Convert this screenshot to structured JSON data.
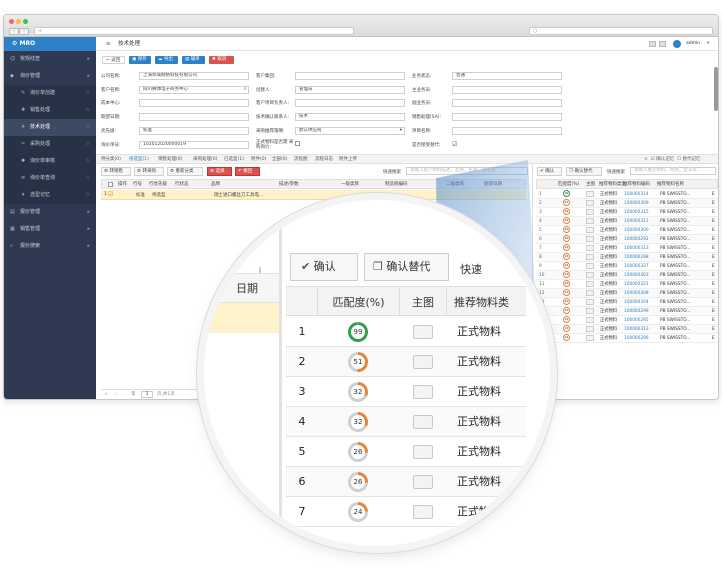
{
  "app": {
    "brand": "MRO",
    "title": "技术处理",
    "user": "admin"
  },
  "sidebar": {
    "items": [
      {
        "label": "常规线查",
        "icon": "user-icon"
      },
      {
        "label": "询价管理",
        "icon": "tag-icon"
      },
      {
        "label": "询价单创建",
        "icon": "pencil-icon",
        "sub": true
      },
      {
        "label": "销售处理",
        "icon": "cart-icon",
        "sub": true
      },
      {
        "label": "技术处理",
        "icon": "wrench-icon",
        "sub": true,
        "active": true
      },
      {
        "label": "采购处理",
        "icon": "gavel-icon",
        "sub": true
      },
      {
        "label": "询价单审核",
        "icon": "gear-icon",
        "sub": true
      },
      {
        "label": "询价单查询",
        "icon": "list-icon",
        "sub": true
      },
      {
        "label": "选型记忆",
        "icon": "bulb-icon",
        "sub": true
      },
      {
        "label": "报价管理",
        "icon": "doc-icon"
      },
      {
        "label": "销售管理",
        "icon": "chart-icon"
      },
      {
        "label": "报价搜索",
        "icon": "search-icon"
      }
    ]
  },
  "toolbar": {
    "back": "返回",
    "save": "保存",
    "export": "导出",
    "print": "辅单",
    "cancel": "取消"
  },
  "form": {
    "company_label": "公司名称:",
    "company": "上海邦城网络科技有限公司",
    "customer_label": "客户名称:",
    "customer": "四川腾博电子商务中心",
    "cost_label": "成本中心:",
    "cost": "",
    "expect_label": "期望日期:",
    "expect": "",
    "priority_label": "优先级:",
    "priority": "标准",
    "inq_label": "询价单号:",
    "inq": "102012020000019",
    "group_label": "客户集团:",
    "group": "",
    "creator_label": "创建人:",
    "creator": "管理员",
    "pm_label": "客户项目负责人:",
    "pm": "",
    "tech_label": "技术确认联系人:",
    "tech": "技术",
    "strategy_label": "采购推荐策略:",
    "strategy": "默认供应商",
    "formal_label": "正式物料是否需 采购询价:",
    "status_label": "业务状态:",
    "status": "普通",
    "owner_label": "主业务员:",
    "owner": "",
    "vice_label": "副业务员:",
    "vice": "",
    "asst_label": "销售助理(SA):",
    "asst": "",
    "project_label": "项目名称:",
    "project": "",
    "alt_label": "是否接受替代:"
  },
  "tabs": [
    "待分类(0)",
    "待选型(1)",
    "销售处理(0)",
    "采购处理(0)",
    "已选型(1)",
    "附件(0)",
    "全部(0)",
    "流程图",
    "流程日志",
    "附件上传"
  ],
  "left_tools": [
    "转销售",
    "转采购",
    "重新分类",
    "选择",
    "撤回"
  ],
  "quick_search": "快速搜索",
  "quick_placeholder": "请输入客户物料描述，品牌，名称，型号等",
  "left_table": {
    "headers": [
      "操作",
      "行号",
      "行优先级",
      "行状态",
      "品牌",
      "描述/参数",
      "一级类目",
      "制造商编码",
      "二级类目",
      "期望日期"
    ],
    "row": [
      "1",
      "标准",
      "待选型",
      "",
      "瑞士进口螺丝刀工具电...",
      "",
      "",
      "",
      ""
    ]
  },
  "pager": {
    "page": "1",
    "total": "页,共1页"
  },
  "right": {
    "confirm": "确认",
    "confirm_alt": "确认替代",
    "quick": "快速搜索",
    "placeholder": "请输入推荐物料，规格，型号等",
    "chk1": "确认记忆",
    "chk2": "替代记忆",
    "headers": [
      "匹配度(%)",
      "主图",
      "推荐物料类型",
      "推荐物料编码",
      "推荐物料名称"
    ],
    "rows": [
      {
        "n": "1",
        "score": "99",
        "type": "正式物料",
        "code": "100000314",
        "name": "PB SWISSTO..."
      },
      {
        "n": "2",
        "score": "51",
        "type": "正式物料",
        "code": "100000309",
        "name": "PB SWISSTO..."
      },
      {
        "n": "3",
        "score": "32",
        "type": "正式物料",
        "code": "100000315",
        "name": "PB SWISSTO..."
      },
      {
        "n": "4",
        "score": "32",
        "type": "正式物料",
        "code": "100000311",
        "name": "PB SWISSTO..."
      },
      {
        "n": "5",
        "score": "26",
        "type": "正式物料",
        "code": "100000300",
        "name": "PB SWISSTO..."
      },
      {
        "n": "6",
        "score": "26",
        "type": "正式物料",
        "code": "100000292",
        "name": "PB SWISSTO..."
      },
      {
        "n": "7",
        "score": "24",
        "type": "正式物料",
        "code": "100000313",
        "name": "PB SWISSTO..."
      },
      {
        "n": "8",
        "score": "24",
        "type": "正式物料",
        "code": "100000298",
        "name": "PB SWISSTO..."
      },
      {
        "n": "9",
        "score": "24",
        "type": "正式物料",
        "code": "100000327",
        "name": "PB SWISSTO..."
      },
      {
        "n": "10",
        "score": "23",
        "type": "正式物料",
        "code": "100000303",
        "name": "PB SWISSTO..."
      },
      {
        "n": "11",
        "score": "23",
        "type": "正式物料",
        "code": "100000321",
        "name": "PB SWISSTO..."
      },
      {
        "n": "12",
        "score": "23",
        "type": "正式物料",
        "code": "100000308",
        "name": "PB SWISSTO..."
      },
      {
        "n": "13",
        "score": "23",
        "type": "正式物料",
        "code": "100000304",
        "name": "PB SWISSTO..."
      },
      {
        "n": "14",
        "score": "23",
        "type": "正式物料",
        "code": "100000299",
        "name": "PB SWISSTO..."
      },
      {
        "n": "15",
        "score": "22",
        "type": "正式物料",
        "code": "100000295",
        "name": "PB SWISSTO..."
      },
      {
        "n": "16",
        "score": "22",
        "type": "正式物料",
        "code": "100000313",
        "name": "PB SWISSTO..."
      },
      {
        "n": "17",
        "score": "22",
        "type": "正式物料",
        "code": "100000296",
        "name": "PB SWISSTO..."
      }
    ]
  },
  "magnifier": {
    "confirm": "确认",
    "confirm_alt": "确认替代",
    "quick": "快速",
    "date_col": "日期",
    "match": "匹配度(%)",
    "img": "主图",
    "type": "推荐物料类",
    "rows": [
      {
        "n": "1",
        "score": 99,
        "type": "正式物料"
      },
      {
        "n": "2",
        "score": 51,
        "type": "正式物料"
      },
      {
        "n": "3",
        "score": 32,
        "type": "正式物料"
      },
      {
        "n": "4",
        "score": 32,
        "type": "正式物料"
      },
      {
        "n": "5",
        "score": 26,
        "type": "正式物料"
      },
      {
        "n": "6",
        "score": 26,
        "type": "正式物料"
      },
      {
        "n": "7",
        "score": 24,
        "type": "正式物"
      }
    ]
  },
  "colors": {
    "green": "#2e9e4f",
    "orange": "#e8823a",
    "blue": "#2e80c7",
    "red": "#d9534f"
  }
}
